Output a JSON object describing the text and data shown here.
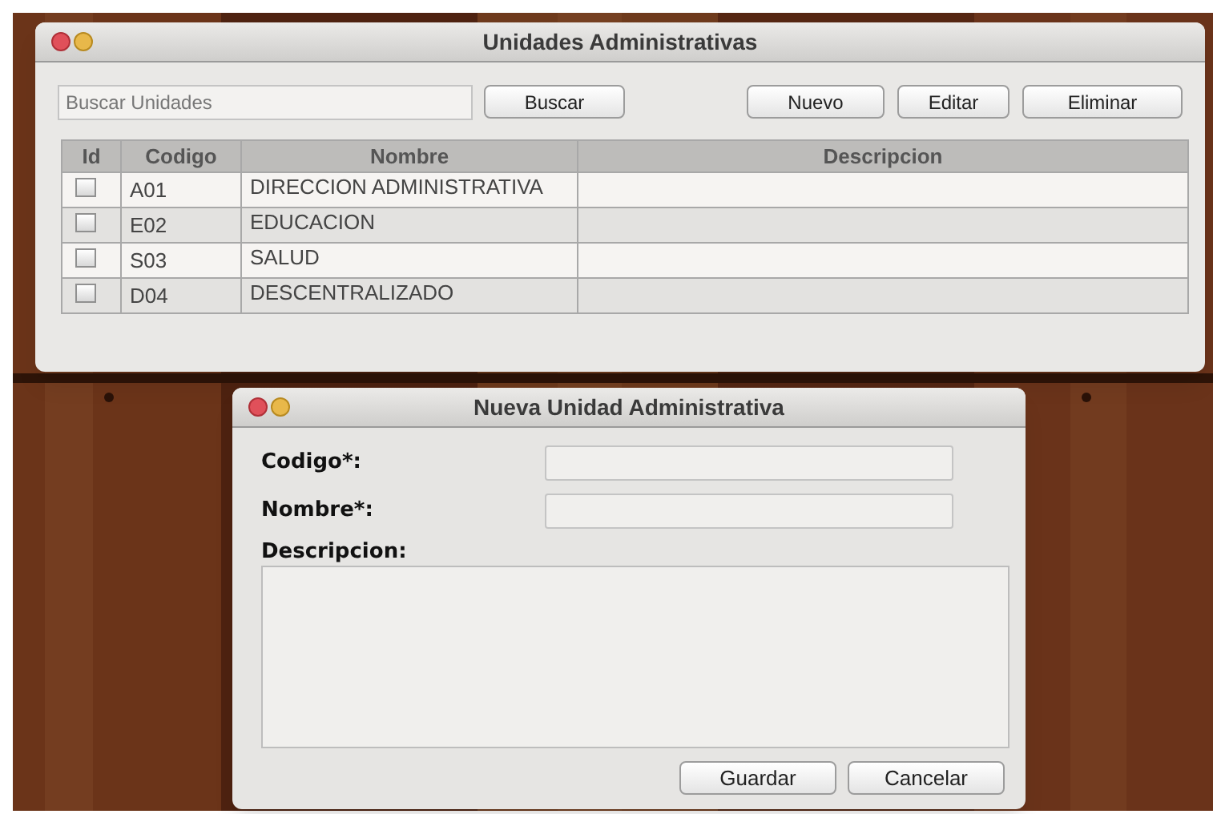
{
  "main_window": {
    "title": "Unidades Administrativas",
    "search": {
      "placeholder": "Buscar Unidades",
      "button": "Buscar"
    },
    "buttons": [
      "Nuevo",
      "Editar",
      "Eliminar"
    ],
    "table": {
      "columns": [
        "Id",
        "Codigo",
        "Nombre",
        "Descripcion"
      ],
      "rows": [
        {
          "checked": false,
          "codigo": "A01",
          "nombre": "DIRECCION ADMINISTRATIVA"
        },
        {
          "checked": false,
          "codigo": "E02",
          "nombre": "EDUCACION"
        },
        {
          "checked": false,
          "codigo": "S03",
          "nombre": "SALUD"
        },
        {
          "checked": false,
          "codigo": "D04",
          "nombre": "DESCENTRALIZADO"
        }
      ]
    }
  },
  "dialog": {
    "title": "Nueva Unidad Administrativa",
    "fields": [
      {
        "kind": "line",
        "label": "Codigo*:"
      },
      {
        "kind": "line",
        "label": "Nombre*:"
      },
      {
        "kind": "area",
        "label": "Descripcion:"
      }
    ],
    "buttons": [
      "Guardar",
      "Cancelar"
    ]
  }
}
